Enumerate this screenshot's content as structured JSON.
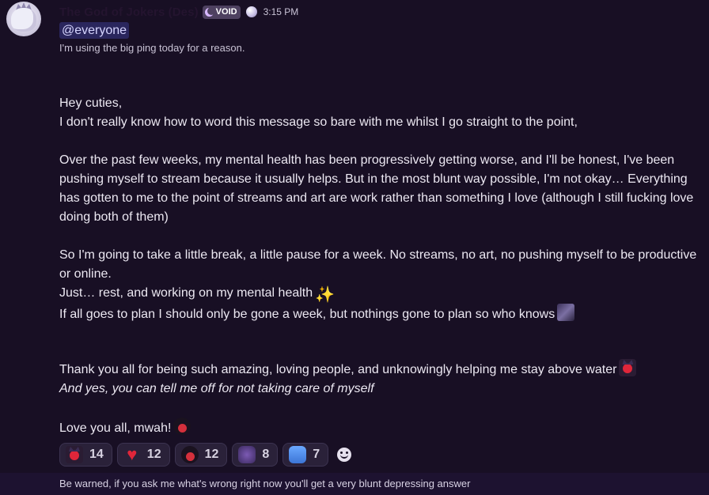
{
  "author": {
    "name": "The God of Jokers (Des)",
    "role_tag": "VOID",
    "timestamp": "3:15 PM"
  },
  "mention": "@everyone",
  "subnote": "I'm using the big ping today for a reason.",
  "message": {
    "line_greeting": "Hey cuties,",
    "line_intro": "I don't really know how to word this message so bare with me whilst I go straight to the point,",
    "para_1": "Over the past few weeks, my mental health has been progressively getting worse, and I'll be honest, I've been pushing myself to stream because it usually helps. But in the most blunt way possible, I'm not okay… Everything has gotten to me to the point of streams and art are work rather than something I love (although I still fucking love doing both of them)",
    "para_2": "So I'm going to take a little break, a little pause for a week. No streams, no art, no pushing myself to be productive or online.",
    "line_rest": "Just… rest, and working on my mental health",
    "line_plan": "If all goes to plan I should only be gone a week, but nothings gone to plan so who knows",
    "line_thanks": "Thank you all for being such amazing, loving people, and unknowingly helping me stay above water",
    "line_italic": "And yes, you can tell me off for not taking care of myself",
    "line_love": "Love you all, mwah!"
  },
  "reactions": [
    {
      "icon": "devil-emoji",
      "count": "14"
    },
    {
      "icon": "heart-emoji",
      "count": "12"
    },
    {
      "icon": "blob-emoji",
      "count": "12"
    },
    {
      "icon": "purple-emoji",
      "count": "8"
    },
    {
      "icon": "hug-emoji",
      "count": "7"
    }
  ],
  "next_message": "Be warned, if you ask me what's wrong right now you'll get a very blunt depressing answer",
  "colors": {
    "background": "#180f24",
    "mention_text": "#d6d5ff",
    "heart": "#e0263a",
    "role_tag_bg": "#4e4160"
  }
}
